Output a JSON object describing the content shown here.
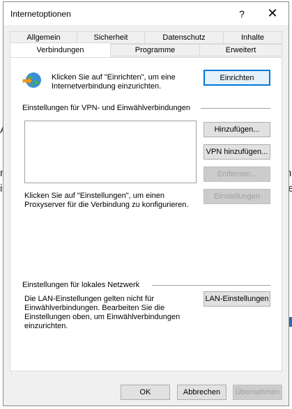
{
  "window": {
    "title": "Internetoptionen",
    "help_glyph": "?",
    "close_glyph": "✕"
  },
  "tabs": {
    "row1": [
      "Allgemein",
      "Sicherheit",
      "Datenschutz",
      "Inhalte"
    ],
    "row2": [
      "Verbindungen",
      "Programme",
      "Erweitert"
    ],
    "active": "Verbindungen"
  },
  "setup": {
    "text": "Klicken Sie auf \"Einrichten\", um eine Internetverbindung einzurichten.",
    "button": "Einrichten",
    "icon": "globe-network-icon"
  },
  "vpn": {
    "heading": "Einstellungen für VPN- und Einwählverbindungen",
    "buttons": {
      "add": "Hinzufügen...",
      "add_vpn": "VPN hinzufügen...",
      "remove": "Entfernen...",
      "settings": "Einstellungen"
    },
    "proxy_text": "Klicken Sie auf \"Einstellungen\", um einen Proxyserver für die Verbindung zu konfigurieren."
  },
  "lan": {
    "heading": "Einstellungen für lokales Netzwerk",
    "text": "Die LAN-Einstellungen gelten nicht für Einwählverbindungen. Bearbeiten Sie die Einstellungen oben, um Einwählverbindungen einzurichten.",
    "button": "LAN-Einstellungen"
  },
  "footer": {
    "ok": "OK",
    "cancel": "Abbrechen",
    "apply": "Übernehmen"
  },
  "colors": {
    "accent": "#0078d7",
    "dialog_bg": "#f0f0f0",
    "panel_bg": "#ffffff"
  }
}
